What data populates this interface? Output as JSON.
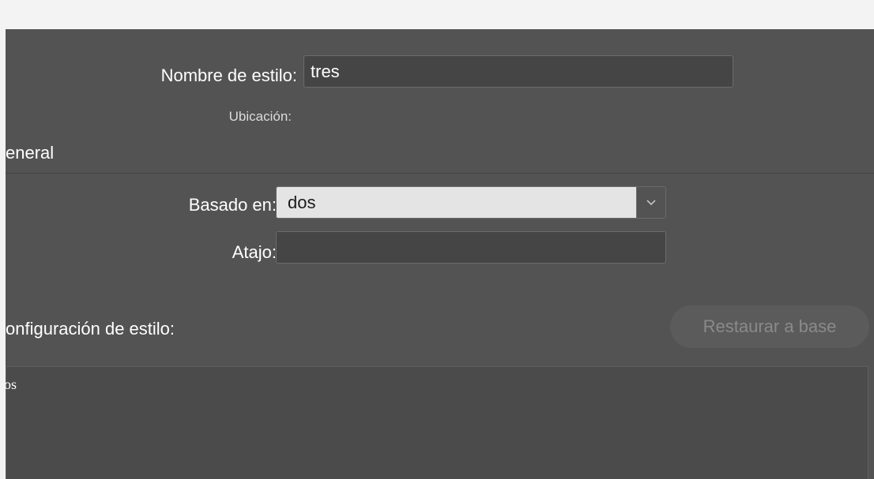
{
  "form": {
    "style_name_label": "Nombre de estilo:",
    "style_name_value": "tres",
    "location_label": "Ubicación:",
    "section_general": "eneral",
    "based_on_label": "Basado en:",
    "based_on_value": "dos",
    "shortcut_label": "Atajo:",
    "shortcut_value": "",
    "section_config": "onfiguración de estilo:",
    "restore_button": "Restaurar a base",
    "description_text": "los"
  },
  "icons": {
    "dropdown": "chevron-down-icon"
  },
  "colors": {
    "panel_bg": "#535353",
    "input_bg": "#454545",
    "select_bg": "#e4e4e4",
    "titlebar_bg": "#f3f3f3"
  }
}
